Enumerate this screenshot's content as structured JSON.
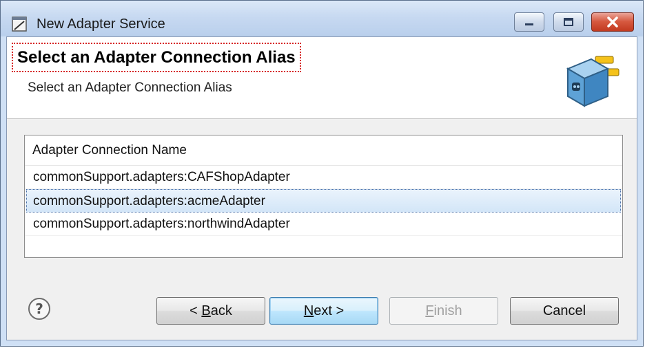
{
  "window": {
    "title": "New Adapter Service"
  },
  "banner": {
    "title": "Select an Adapter Connection Alias",
    "subtitle": "Select an Adapter Connection Alias",
    "icon": "adapter-plug-icon"
  },
  "list": {
    "header": "Adapter Connection Name",
    "rows": [
      "commonSupport.adapters:CAFShopAdapter",
      "commonSupport.adapters:acmeAdapter",
      "commonSupport.adapters:northwindAdapter"
    ],
    "selected_index": 1
  },
  "footer": {
    "help_icon": "question-mark-icon",
    "back_prefix": "< ",
    "back_mnemonic": "B",
    "back_rest": "ack",
    "next_mnemonic": "N",
    "next_rest": "ext >",
    "finish_mnemonic": "F",
    "finish_rest": "inish",
    "cancel_label": "Cancel"
  },
  "colors": {
    "titlebar": "#c7d9f1",
    "close_button": "#d6583f",
    "selection": "#d3e6f8",
    "highlight_border": "#d62424"
  }
}
